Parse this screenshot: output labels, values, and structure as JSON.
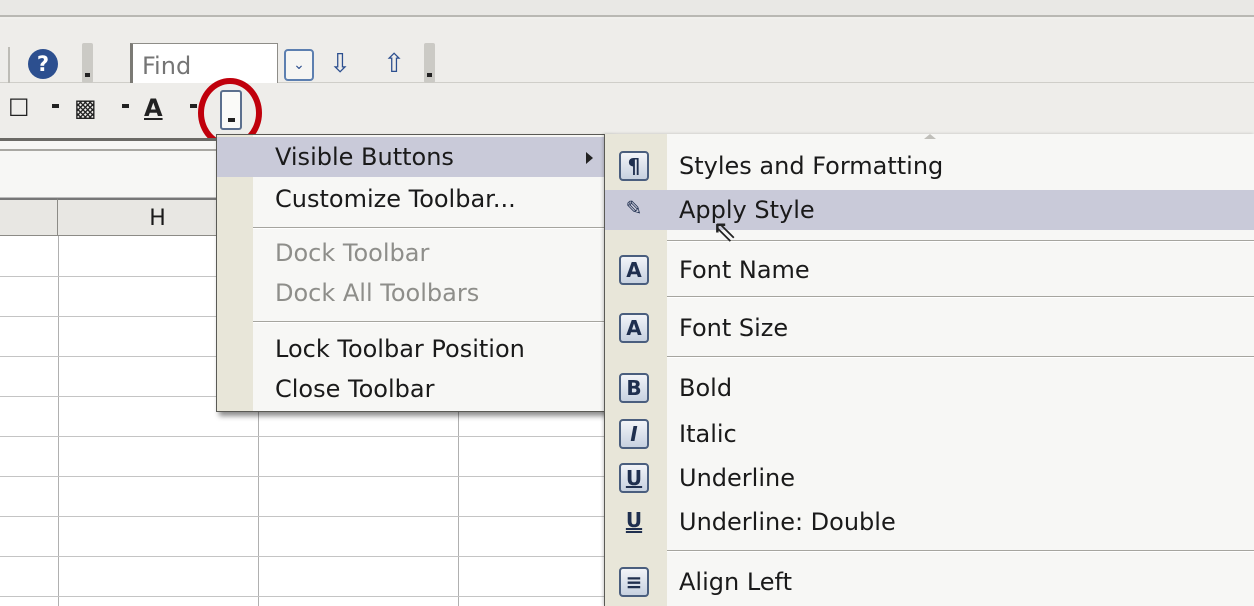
{
  "toolbar": {
    "find_placeholder": "Find",
    "icons": {
      "help": "?",
      "find_dropdown": "⌄",
      "find_next": "⇩",
      "find_prev": "⇧",
      "border": "☐",
      "background_color": "▩",
      "font_color": "A"
    }
  },
  "sheet": {
    "column_header": "H"
  },
  "context_menu": {
    "items": [
      {
        "label": "Visible Buttons",
        "state": "highlighted",
        "has_submenu": true
      },
      {
        "label": "Customize Toolbar...",
        "state": "enabled"
      },
      {
        "label": "Dock Toolbar",
        "state": "disabled"
      },
      {
        "label": "Dock All Toolbars",
        "state": "disabled"
      },
      {
        "label": "Lock Toolbar Position",
        "state": "enabled"
      },
      {
        "label": "Close Toolbar",
        "state": "enabled"
      }
    ]
  },
  "submenu": {
    "items": [
      {
        "label": "Styles and Formatting",
        "icon": "styles-icon",
        "glyph": "¶"
      },
      {
        "label": "Apply Style",
        "icon": "apply-style-icon",
        "glyph": "✎",
        "state": "highlighted"
      },
      {
        "label": "Font Name",
        "icon": "font-name-icon",
        "glyph": "A"
      },
      {
        "label": "Font Size",
        "icon": "font-size-icon",
        "glyph": "A"
      },
      {
        "label": "Bold",
        "icon": "bold-icon",
        "glyph": "B"
      },
      {
        "label": "Italic",
        "icon": "italic-icon",
        "glyph": "I"
      },
      {
        "label": "Underline",
        "icon": "underline-icon",
        "glyph": "U"
      },
      {
        "label": "Underline: Double",
        "icon": "double-underline-icon",
        "glyph": "U"
      },
      {
        "label": "Align Left",
        "icon": "align-left-icon",
        "glyph": "≡"
      }
    ]
  },
  "colors": {
    "highlight_circle": "#c0000c",
    "menu_highlight": "#c9cad9",
    "icon_blue": "#2c4f8f"
  }
}
